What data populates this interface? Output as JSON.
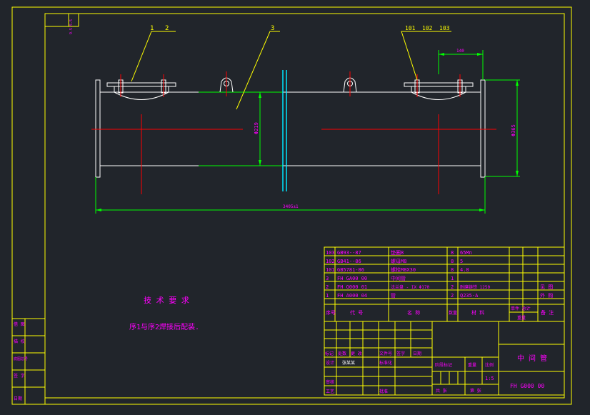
{
  "colors": {
    "background": "#21252b",
    "frame": "#ffff00",
    "part_outline": "#ffffff",
    "centerline": "#ff0000",
    "dimension": "#00ff00",
    "leader": "#ffff00",
    "text": "#ff00ff",
    "flange_bar": "#00e5ff"
  },
  "corner_stamp": "9.5.5.5",
  "balloons": [
    {
      "label": "1"
    },
    {
      "label": "2"
    },
    {
      "label": "3"
    },
    {
      "label": "101"
    },
    {
      "label": "102"
    },
    {
      "label": "103"
    }
  ],
  "dimensions": {
    "overall_length": "3405±1",
    "pipe_diameter": "Φ219",
    "flange_diameter": "Φ365",
    "flange_offset": "140"
  },
  "tech_notes": {
    "title": "技 术 要 求",
    "line1": "序1与序2焊接后配装."
  },
  "bom_rows": [
    {
      "no": "103",
      "code": "GB93--87",
      "name": "垫圈8",
      "qty": "8",
      "material": "65Mn",
      "w1": "",
      "w2": "",
      "note": ""
    },
    {
      "no": "102",
      "code": "GB41--86",
      "name": "螺母M8",
      "qty": "8",
      "material": "5",
      "w1": "",
      "w2": "",
      "note": ""
    },
    {
      "no": "101",
      "code": "GB5781-86",
      "name": "螺栓M8X30",
      "qty": "8",
      "material": "4.8",
      "w1": "",
      "w2": "",
      "note": ""
    },
    {
      "no": "3",
      "code": "FH GA00 00",
      "name": "中间管",
      "qty": "1",
      "material": "",
      "w1": "",
      "w2": "",
      "note": ""
    },
    {
      "no": "2",
      "code": "FH G000 01",
      "name": "法兰盘 - IX Φ170",
      "qty": "2",
      "material": "耐磨铸铁 1250",
      "w1": "",
      "w2": "",
      "note": "见 图"
    },
    {
      "no": "1",
      "code": "FH A000 04",
      "name": "管",
      "qty": "2",
      "material": "Q235-A",
      "w1": "",
      "w2": "",
      "note": "外 购"
    }
  ],
  "bom_header": {
    "no": "序号",
    "code": "代 号",
    "name": "名 称",
    "qty": "数量",
    "material": "材 料",
    "weight": "单件 总计",
    "weight_sub": "重量",
    "note": "备 注"
  },
  "side_labels": [
    "借 图",
    "描 校",
    "底图总号",
    "签 字",
    "日期"
  ],
  "title_block": {
    "drawing_name": "中 间 管",
    "drawing_no": "FH G000 00",
    "row_labels": [
      "标记",
      "处数",
      "更 改",
      "文件号",
      "签字",
      "日期"
    ],
    "designer_label": "设计",
    "designer_name": "张某某",
    "standard_label": "标准化",
    "review_label": "审核",
    "process_label": "工艺",
    "approve_label": "批准",
    "stage_label": "阶段标记",
    "weight_label": "重量",
    "scale_label": "比例",
    "scale": "1:5",
    "sheet_total": "共 张",
    "sheet_no": "第 张"
  }
}
